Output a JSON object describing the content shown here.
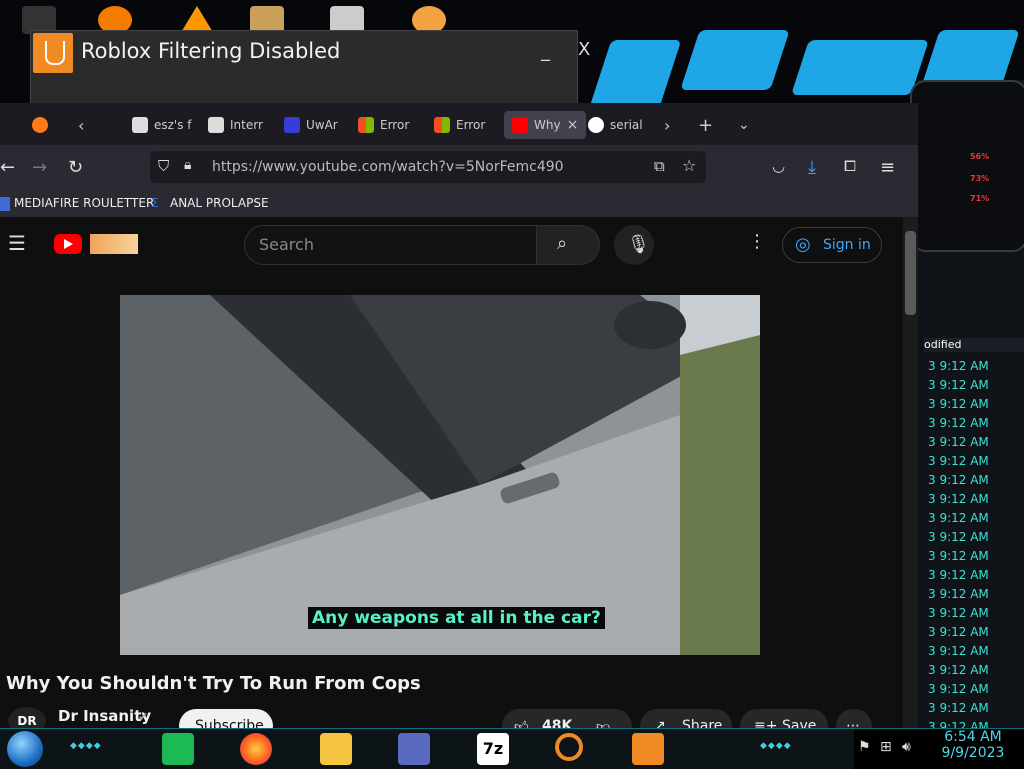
{
  "desktop": {
    "dialog": {
      "title": "Roblox Filtering Disabled",
      "minimize": "_",
      "close": "X"
    }
  },
  "browser": {
    "tabs": [
      {
        "label": "esz's f"
      },
      {
        "label": "Interr"
      },
      {
        "label": "UwAr"
      },
      {
        "label": "Error"
      },
      {
        "label": "Error"
      },
      {
        "label": "Why",
        "sub": "PLAY",
        "active": true
      },
      {
        "label": "serial"
      }
    ],
    "url": "https://www.youtube.com/watch?v=5NorFemc490",
    "bookmarks": [
      "MEDIAFIRE ROULETTER",
      "ANAL PROLAPSE"
    ]
  },
  "youtube": {
    "search_placeholder": "Search",
    "sign_in": "Sign in",
    "caption": "Any weapons at all in the car?",
    "video_title": "Why You Shouldn't Try To Run From Cops",
    "channel_name": "Dr Insanity",
    "channel_avatar_text": "DR",
    "subscribe": "Subscribe",
    "likes": "48K",
    "share": "Share",
    "save": "Save"
  },
  "side_panel": {
    "header": "odified",
    "stats": [
      "56%",
      "73%",
      "71%"
    ],
    "rows": [
      "3 9:12 AM",
      "3 9:12 AM",
      "3 9:12 AM",
      "3 9:12 AM",
      "3 9:12 AM",
      "3 9:12 AM",
      "3 9:12 AM",
      "3 9:12 AM",
      "3 9:12 AM",
      "3 9:12 AM",
      "3 9:12 AM",
      "3 9:12 AM",
      "3 9:12 AM",
      "3 9:12 AM",
      "3 9:12 AM",
      "3 9:12 AM",
      "3 9:12 AM",
      "3 9:12 AM",
      "3 9:12 AM",
      "3 9:12 AM"
    ]
  },
  "taskbar": {
    "time": "6:54 AM",
    "date": "9/9/2023",
    "apps": [
      "spotify-icon",
      "firefox-icon",
      "file-explorer-icon",
      "control-panel-icon",
      "7zip-icon",
      "search-tool-icon",
      "lab-app-icon"
    ],
    "seven_zip_label": "7z"
  },
  "colors": {
    "accent": "#3ea6ff",
    "caption": "#59f0c8",
    "tray_text": "#4fd8ea",
    "yt_red": "#ff0000"
  }
}
